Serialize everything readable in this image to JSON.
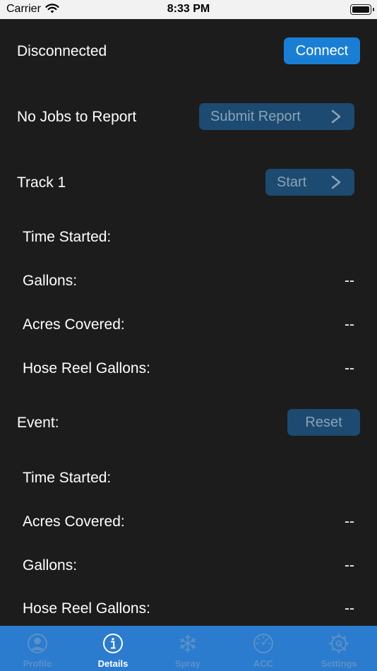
{
  "status_bar": {
    "carrier": "Carrier",
    "time": "8:33 PM"
  },
  "connection": {
    "status": "Disconnected",
    "button_label": "Connect"
  },
  "report": {
    "status": "No Jobs to Report",
    "button_label": "Submit Report"
  },
  "track": {
    "title": "Track 1",
    "button_label": "Start",
    "rows": [
      {
        "label": "Time Started:",
        "value": ""
      },
      {
        "label": "Gallons:",
        "value": "--"
      },
      {
        "label": "Acres Covered:",
        "value": "--"
      },
      {
        "label": "Hose Reel Gallons:",
        "value": "--"
      }
    ]
  },
  "event": {
    "title": "Event:",
    "button_label": "Reset",
    "rows": [
      {
        "label": "Time Started:",
        "value": ""
      },
      {
        "label": "Acres Covered:",
        "value": "--"
      },
      {
        "label": "Gallons:",
        "value": "--"
      },
      {
        "label": "Hose Reel Gallons:",
        "value": "--"
      }
    ]
  },
  "tab_bar": {
    "selected": "Details",
    "tabs": [
      {
        "label": "Profile",
        "icon": "person-circle-icon"
      },
      {
        "label": "Details",
        "icon": "info-circle-icon"
      },
      {
        "label": "Spray",
        "icon": "snowflake-icon"
      },
      {
        "label": "ACC",
        "icon": "gauge-icon"
      },
      {
        "label": "Settings",
        "icon": "gear-icon"
      }
    ]
  },
  "colors": {
    "background": "#1c1c1c",
    "button_active": "#1a7fd4",
    "button_disabled": "#1d4a70",
    "tab_bar": "#2b7bcf"
  }
}
